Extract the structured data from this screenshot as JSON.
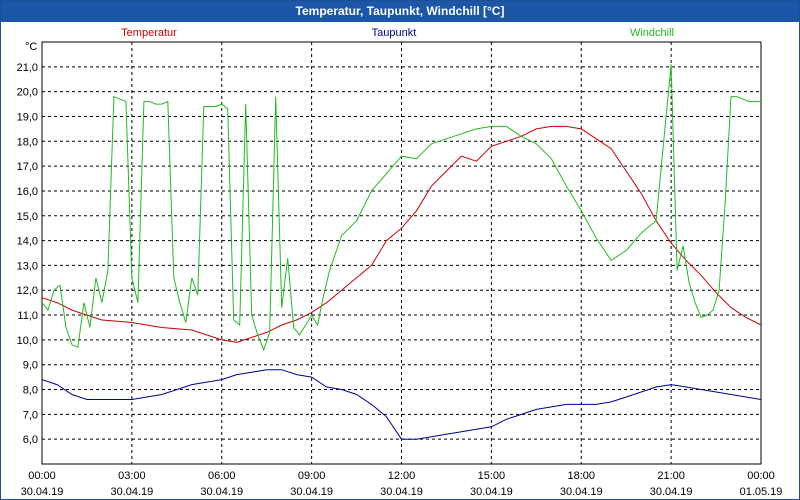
{
  "window": {
    "title": "Temperatur, Taupunkt, Windchill [°C]"
  },
  "chart_data": {
    "type": "line",
    "title": "Temperatur, Taupunkt, Windchill [°C]",
    "ylabel": "°C",
    "ylim": [
      5.0,
      22.0
    ],
    "xlim": [
      "00:00",
      "24:00"
    ],
    "y_ticks": [
      "6,0",
      "7,0",
      "8,0",
      "9,0",
      "10,0",
      "11,0",
      "12,0",
      "13,0",
      "14,0",
      "15,0",
      "16,0",
      "17,0",
      "18,0",
      "19,0",
      "20,0",
      "21,0"
    ],
    "x_ticks": [
      {
        "time": "00:00",
        "date": "30.04.19"
      },
      {
        "time": "03:00",
        "date": "30.04.19"
      },
      {
        "time": "06:00",
        "date": "30.04.19"
      },
      {
        "time": "09:00",
        "date": "30.04.19"
      },
      {
        "time": "12:00",
        "date": "30.04.19"
      },
      {
        "time": "15:00",
        "date": "30.04.19"
      },
      {
        "time": "18:00",
        "date": "30.04.19"
      },
      {
        "time": "21:00",
        "date": "30.04.19"
      },
      {
        "time": "00:00",
        "date": "01.05.19"
      }
    ],
    "grid": true,
    "legend": "top",
    "series": [
      {
        "name": "Temperatur",
        "color": "#cc0000",
        "x": [
          0,
          0.5,
          1,
          1.5,
          2,
          3,
          4,
          5,
          6,
          6.5,
          7,
          7.5,
          8,
          8.5,
          9,
          9.5,
          10,
          10.5,
          11,
          11.5,
          12,
          12.5,
          13,
          13.5,
          14,
          14.5,
          15,
          15.5,
          16,
          16.5,
          17,
          17.5,
          18,
          18.5,
          19,
          19.5,
          20,
          20.5,
          21,
          21.5,
          22,
          22.5,
          23,
          23.5,
          24
        ],
        "y": [
          11.7,
          11.5,
          11.2,
          11.0,
          10.8,
          10.7,
          10.5,
          10.4,
          10.0,
          9.9,
          10.1,
          10.3,
          10.6,
          10.8,
          11.1,
          11.5,
          12.0,
          12.5,
          13.0,
          14.0,
          14.5,
          15.2,
          16.2,
          16.8,
          17.4,
          17.2,
          17.8,
          18.0,
          18.2,
          18.5,
          18.6,
          18.6,
          18.5,
          18.1,
          17.7,
          16.8,
          15.9,
          14.8,
          13.9,
          13.2,
          12.6,
          11.9,
          11.3,
          10.9,
          10.6
        ]
      },
      {
        "name": "Taupunkt",
        "color": "#000099",
        "x": [
          0,
          0.5,
          1,
          1.5,
          2,
          3,
          4,
          5,
          6,
          6.5,
          7,
          7.5,
          8,
          8.5,
          9,
          9.5,
          10,
          10.5,
          11,
          11.5,
          12,
          12.5,
          13,
          13.5,
          14,
          14.5,
          15,
          15.5,
          16,
          16.5,
          17,
          17.5,
          18,
          18.5,
          19,
          19.5,
          20,
          20.5,
          21,
          21.5,
          22,
          22.5,
          23,
          23.5,
          24
        ],
        "y": [
          8.4,
          8.2,
          7.8,
          7.6,
          7.6,
          7.6,
          7.8,
          8.2,
          8.4,
          8.6,
          8.7,
          8.8,
          8.8,
          8.6,
          8.5,
          8.1,
          8.0,
          7.8,
          7.4,
          6.9,
          6.0,
          6.0,
          6.1,
          6.2,
          6.3,
          6.4,
          6.5,
          6.8,
          7.0,
          7.2,
          7.3,
          7.4,
          7.4,
          7.4,
          7.5,
          7.7,
          7.9,
          8.1,
          8.2,
          8.1,
          8.0,
          7.9,
          7.8,
          7.7,
          7.6
        ]
      },
      {
        "name": "Windchill",
        "color": "#22bb22",
        "x": [
          0,
          0.2,
          0.4,
          0.6,
          0.8,
          1,
          1.2,
          1.4,
          1.6,
          1.8,
          2,
          2.2,
          2.4,
          2.6,
          2.8,
          3,
          3.2,
          3.4,
          3.6,
          3.8,
          4,
          4.2,
          4.4,
          4.6,
          4.8,
          5,
          5.2,
          5.4,
          5.6,
          5.8,
          6,
          6.2,
          6.4,
          6.6,
          6.8,
          7,
          7.2,
          7.4,
          7.6,
          7.8,
          8,
          8.2,
          8.4,
          8.6,
          8.8,
          9,
          9.2,
          9.4,
          9.6,
          9.8,
          10,
          10.5,
          11,
          11.5,
          12,
          12.5,
          13,
          13.5,
          14,
          14.5,
          15,
          15.5,
          16,
          16.5,
          17,
          17.5,
          18,
          18.5,
          19,
          19.5,
          20,
          20.5,
          21,
          21.2,
          21.4,
          21.6,
          21.8,
          22,
          22.2,
          22.4,
          22.6,
          22.8,
          23,
          23.2,
          23.4,
          23.6,
          23.8,
          24
        ],
        "y": [
          11.5,
          11.2,
          12.0,
          12.2,
          10.5,
          9.8,
          9.7,
          11.5,
          10.5,
          12.5,
          11.5,
          12.8,
          19.8,
          19.7,
          19.6,
          12.5,
          11.5,
          19.6,
          19.6,
          19.5,
          19.5,
          19.6,
          12.5,
          11.5,
          10.7,
          12.5,
          11.8,
          19.4,
          19.4,
          19.4,
          19.5,
          19.3,
          10.8,
          10.6,
          19.5,
          11.0,
          10.2,
          9.6,
          10.3,
          19.8,
          11.3,
          13.3,
          10.5,
          10.2,
          10.6,
          11.0,
          10.6,
          11.8,
          12.8,
          13.5,
          14.2,
          14.8,
          16.0,
          16.7,
          17.4,
          17.3,
          17.9,
          18.1,
          18.3,
          18.5,
          18.6,
          18.6,
          18.2,
          17.9,
          17.3,
          16.2,
          15.2,
          14.1,
          13.2,
          13.6,
          14.3,
          14.8,
          21.1,
          12.8,
          13.8,
          12.3,
          11.5,
          10.9,
          11.0,
          11.2,
          12.0,
          15.5,
          19.8,
          19.8,
          19.7,
          19.6,
          19.6,
          19.6
        ]
      }
    ]
  }
}
